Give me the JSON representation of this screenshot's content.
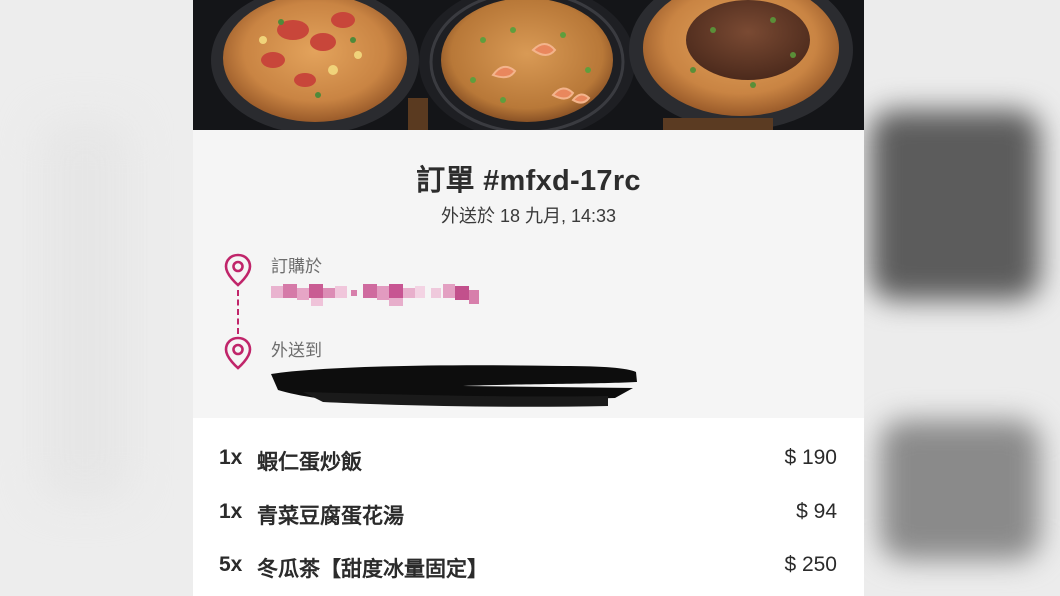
{
  "order": {
    "title": "訂單 #mfxd-17rc",
    "delivery_time": "外送於 18 九月, 14:33"
  },
  "route": {
    "from_label": "訂購於",
    "to_label": "外送到"
  },
  "items": [
    {
      "qty": "1x",
      "name": "蝦仁蛋炒飯",
      "price": "$ 190"
    },
    {
      "qty": "1x",
      "name": "青菜豆腐蛋花湯",
      "price": "$ 94"
    },
    {
      "qty": "5x",
      "name": "冬瓜茶【甜度冰量固定】",
      "price": "$ 250"
    }
  ],
  "colors": {
    "accent": "#c0256a",
    "text": "#2d2d2d",
    "background": "#f5f5f5"
  },
  "icons": {
    "from": "location-pin-icon",
    "to": "location-pin-icon"
  }
}
